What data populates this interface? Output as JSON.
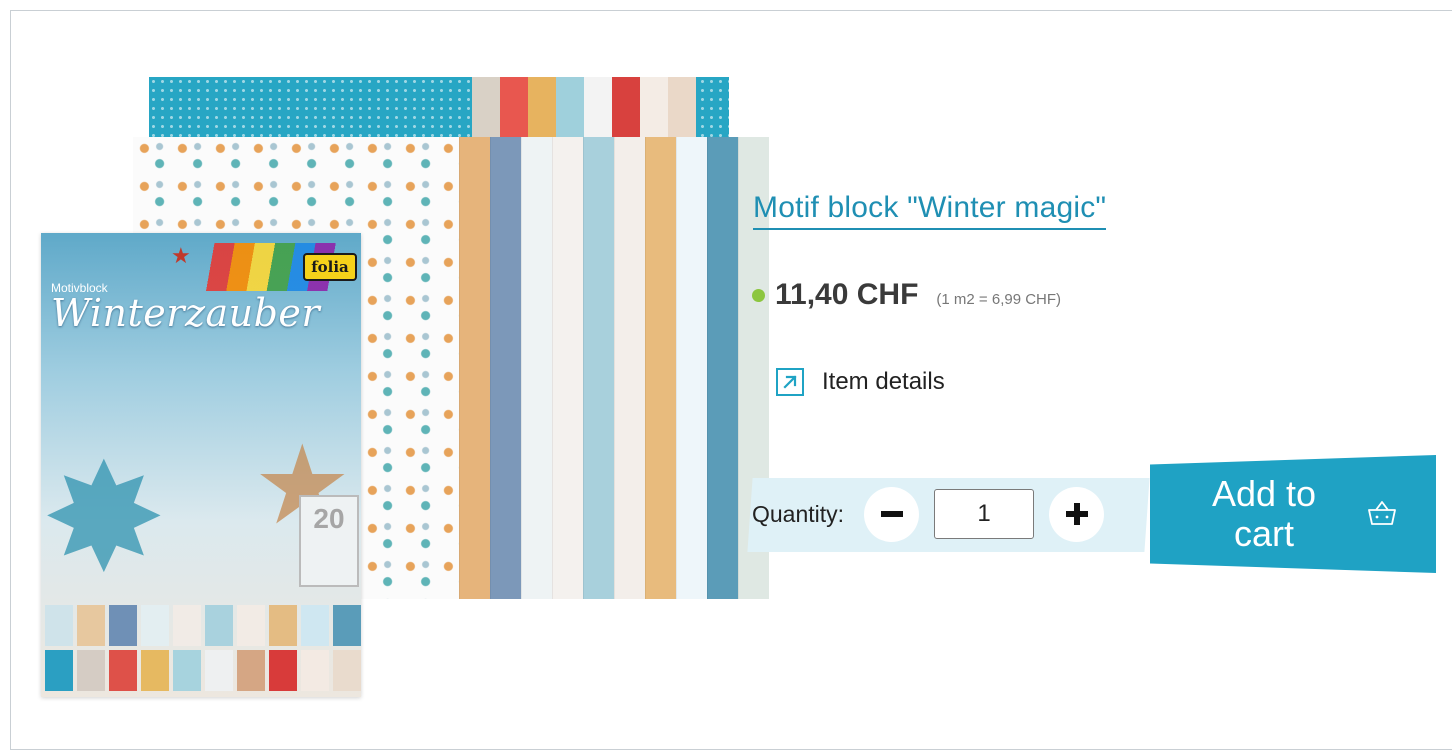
{
  "product": {
    "title": "Motif block \"Winter magic\"",
    "price": "11,40 CHF",
    "unit_price": "(1 m2 = 6,99 CHF)",
    "availability_color": "#8cc63f"
  },
  "details_link": {
    "label": "Item details",
    "icon": "external-link-arrow-icon"
  },
  "quantity": {
    "label": "Quantity:",
    "value": "1",
    "decrement_icon": "minus-icon",
    "increment_icon": "plus-icon"
  },
  "cart": {
    "label": "Add to cart",
    "icon": "shopping-basket-icon"
  },
  "image": {
    "cover_subtitle": "Motivblock",
    "cover_title": "Winterzauber",
    "brand": "folia",
    "sheet_count": "20"
  },
  "colors": {
    "accent": "#1fa2c4",
    "quantity_background": "#dff1f7"
  }
}
